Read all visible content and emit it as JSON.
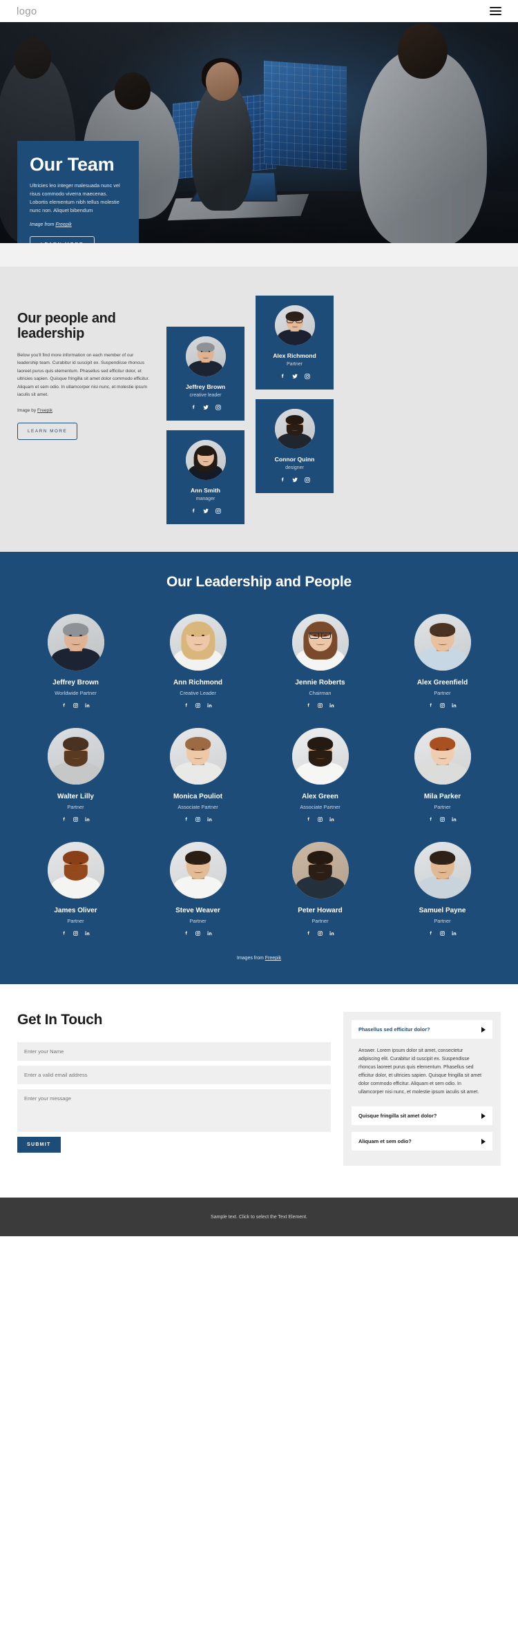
{
  "header": {
    "logo": "logo",
    "menu_icon": "hamburger-menu-icon"
  },
  "hero": {
    "title": "Our Team",
    "body": "Ultricies leo integer malesuada nunc vel risus commodo viverra maecenas. Lobortis elementum nibh tellus molestie nunc non. Aliquet bibendum",
    "credit_prefix": "Image from ",
    "credit_link": "Freepik",
    "button": "LEARN MORE"
  },
  "people": {
    "title": "Our people and leadership",
    "body": "Below you'll find more information on each member of our leadership team. Curabitur id suscipit ex. Suspendisse rhoncus laoreet purus quis elementum. Phasellus sed efficitur dolor, et ultricies sapien. Quisque fringilla sit amet dolor commodo efficitur. Aliquam et sem odio. In ullamcorper nisi nunc, et molestie ipsum iaculis sit amet.",
    "credit_prefix": "Image by ",
    "credit_link": "Freepik",
    "button": "LEARN MORE",
    "cards_mid": [
      {
        "name": "Jeffrey Brown",
        "role": "creative leader",
        "avatar": "man-grey-hair-suit"
      },
      {
        "name": "Ann Smith",
        "role": "manager",
        "avatar": "woman-dark-hair-blazer"
      }
    ],
    "cards_right": [
      {
        "name": "Alex Richmond",
        "role": "Partner",
        "avatar": "man-glasses-suit"
      },
      {
        "name": "Connor Quinn",
        "role": "designer",
        "avatar": "man-beard-suit"
      }
    ],
    "social_icons": [
      "facebook-icon",
      "twitter-icon",
      "instagram-icon"
    ]
  },
  "leadership": {
    "title": "Our Leadership and People",
    "social_icons": [
      "facebook-icon",
      "instagram-icon",
      "linkedin-icon"
    ],
    "credit_prefix": "Images from ",
    "credit_link": "Freepik",
    "members": [
      {
        "name": "Jeffrey Brown",
        "role": "Worldwide Partner",
        "avatar": "man-grey-hair-suit"
      },
      {
        "name": "Ann Richmond",
        "role": "Creative Leader",
        "avatar": "woman-blonde"
      },
      {
        "name": "Jennie Roberts",
        "role": "Chairman",
        "avatar": "woman-glasses-brown-hair"
      },
      {
        "name": "Alex Greenfield",
        "role": "Partner",
        "avatar": "man-young-blue-shirt"
      },
      {
        "name": "Walter Lilly",
        "role": "Partner",
        "avatar": "man-beard-grey-jacket"
      },
      {
        "name": "Monica Pouliot",
        "role": "Associate Partner",
        "avatar": "woman-bob-haircut"
      },
      {
        "name": "Alex Green",
        "role": "Associate Partner",
        "avatar": "man-beard-white-shirt"
      },
      {
        "name": "Mila Parker",
        "role": "Partner",
        "avatar": "woman-red-hair-bun"
      },
      {
        "name": "James Oliver",
        "role": "Partner",
        "avatar": "man-ginger-beard"
      },
      {
        "name": "Steve Weaver",
        "role": "Partner",
        "avatar": "man-dark-hair-white-tshirt"
      },
      {
        "name": "Peter Howard",
        "role": "Partner",
        "avatar": "man-short-beard-tan"
      },
      {
        "name": "Samuel Payne",
        "role": "Partner",
        "avatar": "man-light-shirt"
      }
    ]
  },
  "contact": {
    "title": "Get In Touch",
    "name_placeholder": "Enter your Name",
    "email_placeholder": "Enter a valid email address",
    "message_placeholder": "Enter your message",
    "submit_label": "SUBMIT",
    "faq": [
      {
        "question": "Phasellus sed efficitur dolor?",
        "answer": "Answer. Lorem ipsum dolor sit amet, consectetur adipiscing elit. Curabitur id suscipit ex. Suspendisse rhoncus laoreet purus quis elementum. Phasellus sed efficitur dolor, et ultricies sapien. Quisque fringilla sit amet dolor commodo efficitur. Aliquam et sem odio. In ullamcorper nisi nunc, et molestie ipsum iaculis sit amet.",
        "open": true
      },
      {
        "question": "Quisque fringilla sit amet dolor?",
        "answer": "",
        "open": false
      },
      {
        "question": "Aliquam et sem odio?",
        "answer": "",
        "open": false
      }
    ]
  },
  "footer": {
    "text": "Sample text. Click to select the Text Element."
  },
  "colors": {
    "brand_blue": "#1d4c78",
    "page_grey": "#e5e5e5",
    "field_grey": "#efefef",
    "footer_grey": "#3b3b3b"
  }
}
